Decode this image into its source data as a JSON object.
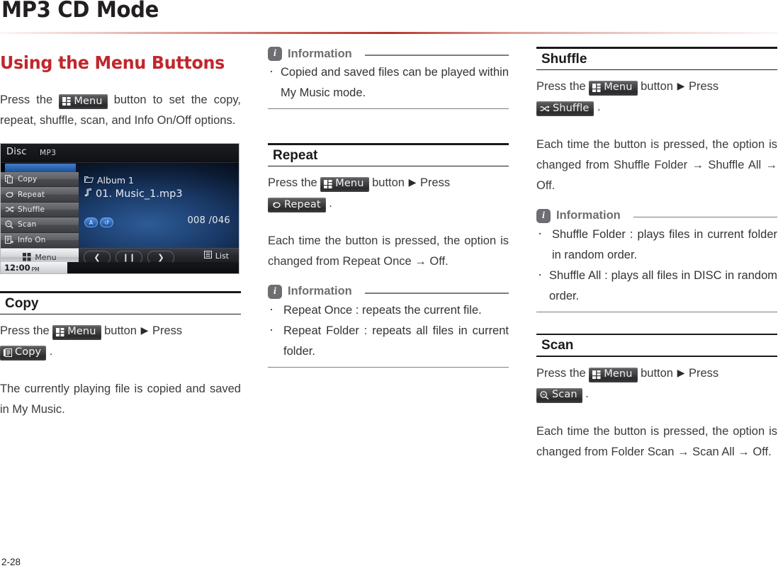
{
  "header": {
    "title": "MP3 CD Mode",
    "rule_color": "#b4372a"
  },
  "footer": {
    "page_number": "2-28"
  },
  "accent_color": "#c0272d",
  "keys": {
    "menu": "Menu",
    "copy": "Copy",
    "repeat": "Repeat",
    "shuffle": "Shuffle",
    "scan": "Scan"
  },
  "column_left": {
    "heading": "Using the Menu Buttons",
    "intro_before": "Press the",
    "intro_after": "button to set the copy, repeat, shuffle, scan, and Info On/Off options.",
    "device": {
      "disc_label": "Disc",
      "format_label": "MP3",
      "menu_items": [
        {
          "label": "Copy",
          "icon": "copy-icon"
        },
        {
          "label": "Repeat",
          "icon": "repeat-icon"
        },
        {
          "label": "Shuffle",
          "icon": "shuffle-icon"
        },
        {
          "label": "Scan",
          "icon": "scan-icon"
        },
        {
          "label": "Info On",
          "icon": "info-on-icon"
        }
      ],
      "menu_button_label": "Menu",
      "album": "Album 1",
      "track": "01. Music_1.mp3",
      "status_badges": [
        "A",
        "↺"
      ],
      "track_count": "008 /046",
      "controls": [
        "❮",
        "❙❙",
        "❯"
      ],
      "list_button_label": "List",
      "clock": "12:00",
      "clock_meridiem": "PM"
    },
    "copy_section": {
      "heading": "Copy",
      "step_prefix": "Press the",
      "step_middle": "button",
      "step_arrow": "▶",
      "step_press": "Press",
      "step_period": ".",
      "body": "The currently playing file is copied and saved in My Music."
    }
  },
  "column_middle": {
    "info_copy": {
      "title": "Information",
      "items": [
        "Copied and saved files can be played within My Music mode."
      ]
    },
    "repeat_section": {
      "heading": "Repeat",
      "step_prefix": "Press the",
      "step_middle": "button",
      "step_arrow": "▶",
      "step_press": "Press",
      "step_period": ".",
      "body": "Each time the button is pressed, the option is changed from Repeat Once → Off."
    },
    "info_repeat": {
      "title": "Information",
      "items": [
        "Repeat Once : repeats the current file.",
        "Repeat Folder : repeats all files in current folder."
      ]
    }
  },
  "column_right": {
    "shuffle_section": {
      "heading": "Shuffle",
      "step_prefix": "Press the",
      "step_middle": "button",
      "step_arrow": "▶",
      "step_press": "Press",
      "step_period": ".",
      "body": "Each time the button is pressed, the option is changed from Shuffle Folder → Shuffle All → Off."
    },
    "info_shuffle": {
      "title": "Information",
      "items": [
        "Shuffle Folder : plays files in current folder in random order.",
        "Shuffle All : plays all files in DISC in random order."
      ]
    },
    "scan_section": {
      "heading": "Scan",
      "step_prefix": "Press the",
      "step_middle": "button",
      "step_arrow": "▶",
      "step_press": "Press",
      "step_period": ".",
      "body": "Each time the button is pressed, the option is changed from Folder Scan → Scan All → Off."
    }
  }
}
